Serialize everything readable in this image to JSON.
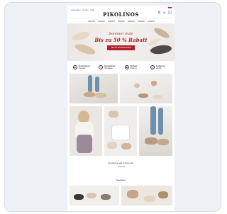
{
  "header": {
    "top_left_text": "Anmelden · Suche · Hilfe",
    "logo": "PIKOLINOS",
    "icons": [
      "search-icon",
      "user-icon",
      "cart-icon"
    ],
    "flag_colors": [
      "#c8102e",
      "#ffffff"
    ]
  },
  "navigation": {
    "item_count": 7
  },
  "hero": {
    "line1": "Sommer Sale",
    "line2": "Bis zu 50 % Rabatt",
    "button_label": "JETZT ENTDECKEN",
    "accent_color": "#b3202a"
  },
  "benefits": [
    {
      "icon": "truck-icon",
      "title": "Kostenloser",
      "subtitle": "Versand"
    },
    {
      "icon": "return-icon",
      "title": "Kostenlose",
      "subtitle": "Rückgabe"
    },
    {
      "icon": "payment-icon",
      "title": "Sichere",
      "subtitle": "Zahlung"
    },
    {
      "icon": "clock-icon",
      "title": "Lieferung",
      "subtitle": "24-48h"
    }
  ],
  "sections": {
    "collection_title": "Entdecke die Kollektion",
    "new_title": "Neuheiten"
  }
}
